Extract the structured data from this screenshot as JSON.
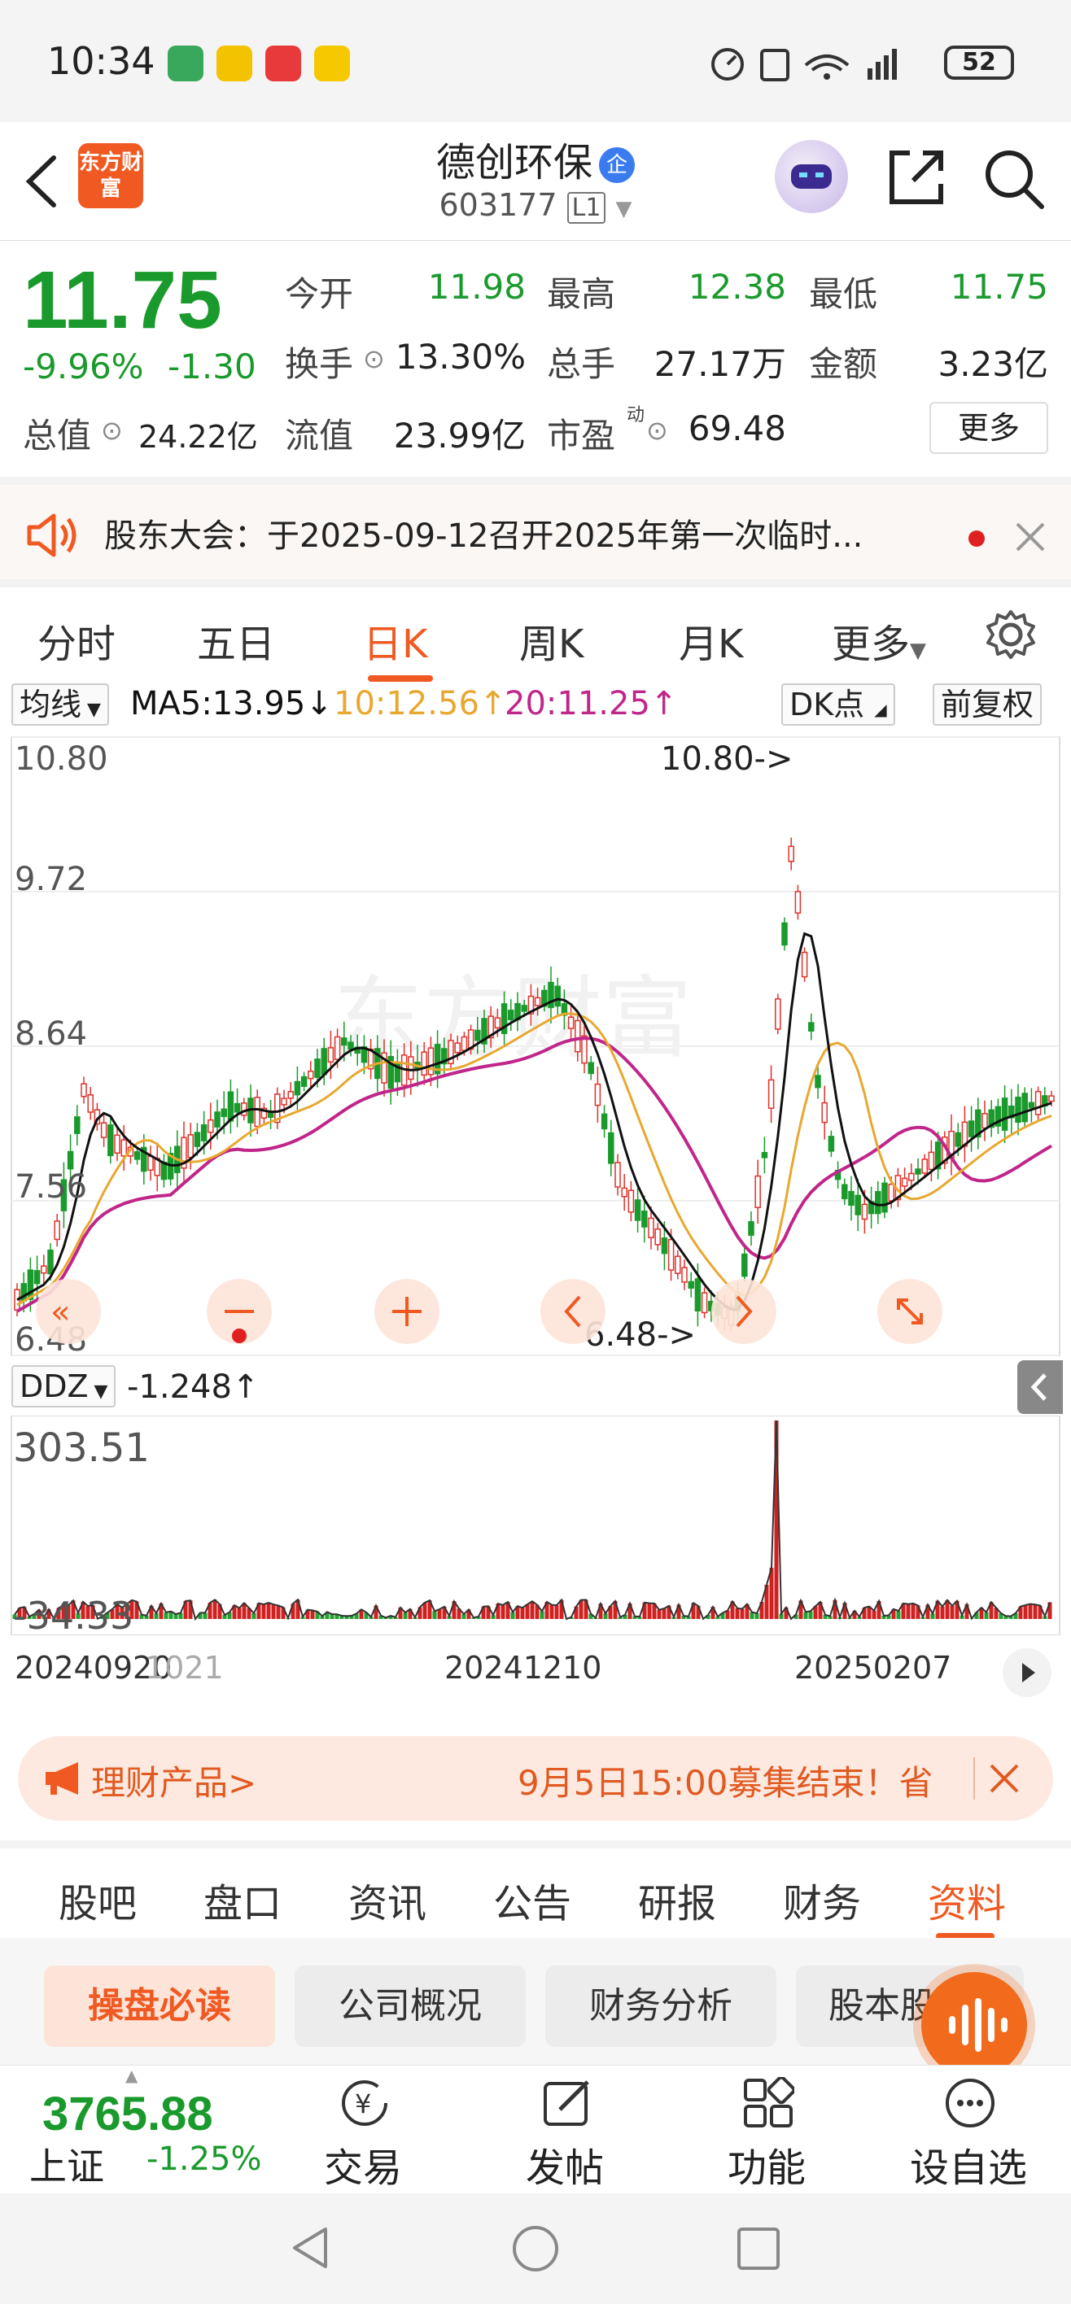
{
  "status_bar": {
    "time": "10:34",
    "battery": "52"
  },
  "header": {
    "app_logo": "东方财富",
    "stock_name": "德创环保",
    "verified_badge": "企",
    "stock_code": "603177",
    "level": "L1"
  },
  "quote": {
    "price": "11.75",
    "change_pct": "-9.96%",
    "change": "-1.30",
    "open_label": "今开",
    "open": "11.98",
    "high_label": "最高",
    "high": "12.38",
    "low_label": "最低",
    "low": "11.75",
    "turnover_label": "换手",
    "turnover": "13.30%",
    "volume_label": "总手",
    "volume": "27.17万",
    "amount_label": "金额",
    "amount": "3.23亿",
    "total_cap_label": "总值",
    "total_cap": "24.22亿",
    "float_cap_label": "流值",
    "float_cap": "23.99亿",
    "pe_label": "市盈",
    "pe_super": "动",
    "pe": "69.48",
    "more_button": "更多"
  },
  "notice": {
    "text": "股东大会：于2025-09-12召开2025年第一次临时..."
  },
  "period_tabs": [
    {
      "label": "分时"
    },
    {
      "label": "五日"
    },
    {
      "label": "日K",
      "active": true
    },
    {
      "label": "周K"
    },
    {
      "label": "月K"
    },
    {
      "label": "更多"
    }
  ],
  "ma_bar": {
    "indicator": "均线",
    "ma5": "MA5:13.95↓",
    "ma10": "10:12.56↑",
    "ma20": "20:11.25↑",
    "dk_button": "DK点",
    "adjust_button": "前复权",
    "colors": {
      "ma5": "#111111",
      "ma10": "#e8a830",
      "ma20": "#c0268a"
    }
  },
  "kline": {
    "y_labels": [
      "10.80",
      "9.72",
      "8.64",
      "7.56",
      "6.48"
    ],
    "max_marker": "10.80->",
    "min_marker": "6.48->",
    "watermark": "东方财富",
    "up_color": "#e0312a",
    "down_color": "#1a9a2c"
  },
  "ddz": {
    "indicator": "DDZ",
    "value": "-1.248↑",
    "y_top": "303.51",
    "y_bottom": "-34.33"
  },
  "dates": [
    "20240920",
    "1021",
    "20241210",
    "20250207"
  ],
  "promo": {
    "left": "理财产品>",
    "right": "9月5日15:00募集结束！省"
  },
  "section_tabs": [
    {
      "label": "股吧"
    },
    {
      "label": "盘口"
    },
    {
      "label": "资讯"
    },
    {
      "label": "公告"
    },
    {
      "label": "研报"
    },
    {
      "label": "财务"
    },
    {
      "label": "资料",
      "active": true
    }
  ],
  "sub_tabs": [
    {
      "label": "操盘必读",
      "active": true
    },
    {
      "label": "公司概况"
    },
    {
      "label": "财务分析"
    },
    {
      "label": "股本股东"
    }
  ],
  "bottom_nav": {
    "index_value": "3765.88",
    "index_name": "上证",
    "index_pct": "-1.25%",
    "items": [
      {
        "label": "交易",
        "icon": "yen-icon"
      },
      {
        "label": "发帖",
        "icon": "edit-icon"
      },
      {
        "label": "功能",
        "icon": "grid-icon"
      },
      {
        "label": "设自选",
        "icon": "more-icon"
      }
    ]
  }
}
